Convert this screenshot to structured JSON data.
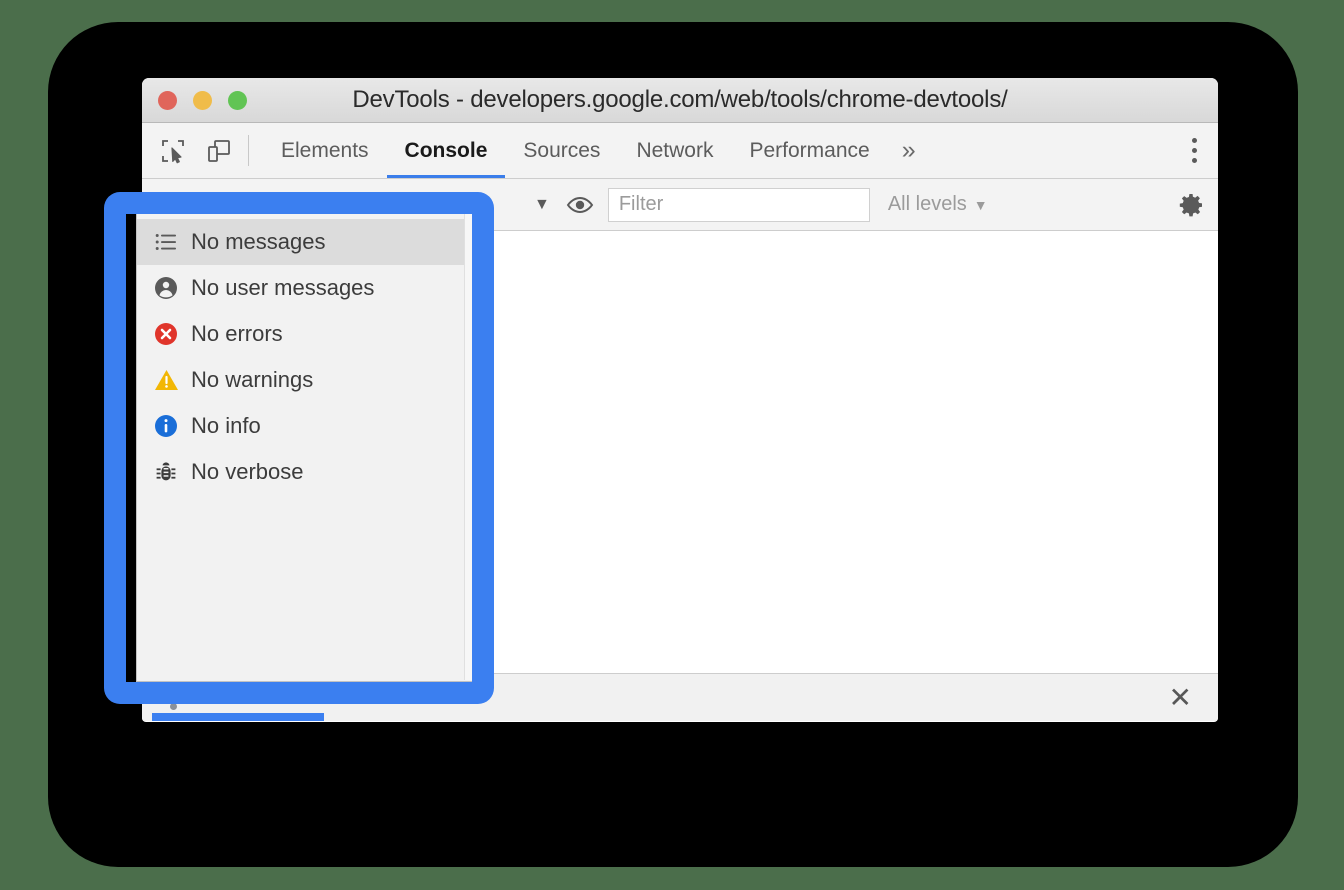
{
  "window": {
    "title": "DevTools - developers.google.com/web/tools/chrome-devtools/",
    "traffic_lights": {
      "close_label": "close",
      "minimize_label": "minimize",
      "maximize_label": "maximize",
      "close_color": "#e0655b",
      "minimize_color": "#f0bc4a",
      "maximize_color": "#61c454"
    }
  },
  "tabbar": {
    "inspect_icon": "inspect-element-icon",
    "device_icon": "device-toolbar-icon",
    "tabs": [
      {
        "label": "Elements",
        "active": false
      },
      {
        "label": "Console",
        "active": true
      },
      {
        "label": "Sources",
        "active": false
      },
      {
        "label": "Network",
        "active": false
      },
      {
        "label": "Performance",
        "active": false
      }
    ],
    "more_label": "»",
    "kebab_label": "Customize and control DevTools",
    "active_underline_color": "#3a7dea"
  },
  "console_toolbar": {
    "context_caret": "▼",
    "eye_icon": "eye-icon",
    "filter": {
      "value": "",
      "placeholder": "Filter"
    },
    "levels": {
      "label": "All levels",
      "caret": "▼"
    },
    "settings_icon": "gear-icon"
  },
  "console_body": {
    "prompt_cursor": "|",
    "messages": []
  },
  "drawer": {
    "close_label": "✕"
  },
  "dropdown": {
    "items": [
      {
        "label": "No messages",
        "icon": "list-icon",
        "icon_color": "#5a5a5a",
        "selected": true
      },
      {
        "label": "No user messages",
        "icon": "person-icon",
        "icon_color": "#5a5a5a",
        "selected": false
      },
      {
        "label": "No errors",
        "icon": "error-icon",
        "icon_color": "#e0352b",
        "selected": false
      },
      {
        "label": "No warnings",
        "icon": "warning-icon",
        "icon_color": "#f2b705",
        "selected": false
      },
      {
        "label": "No info",
        "icon": "info-icon",
        "icon_color": "#1a6ed8",
        "selected": false
      },
      {
        "label": "No verbose",
        "icon": "bug-icon",
        "icon_color": "#3c3c3c",
        "selected": false
      }
    ]
  },
  "annotation": {
    "highlight_color": "#3b7ff0",
    "highlight_label": "console-sidebar-highlight"
  },
  "colors": {
    "page_background": "#4b6e4b",
    "backdrop": "#000000",
    "toolbar_background": "#f3f3f3",
    "menu_background": "#f2f2f2",
    "menu_selected": "#dcdcdc"
  }
}
